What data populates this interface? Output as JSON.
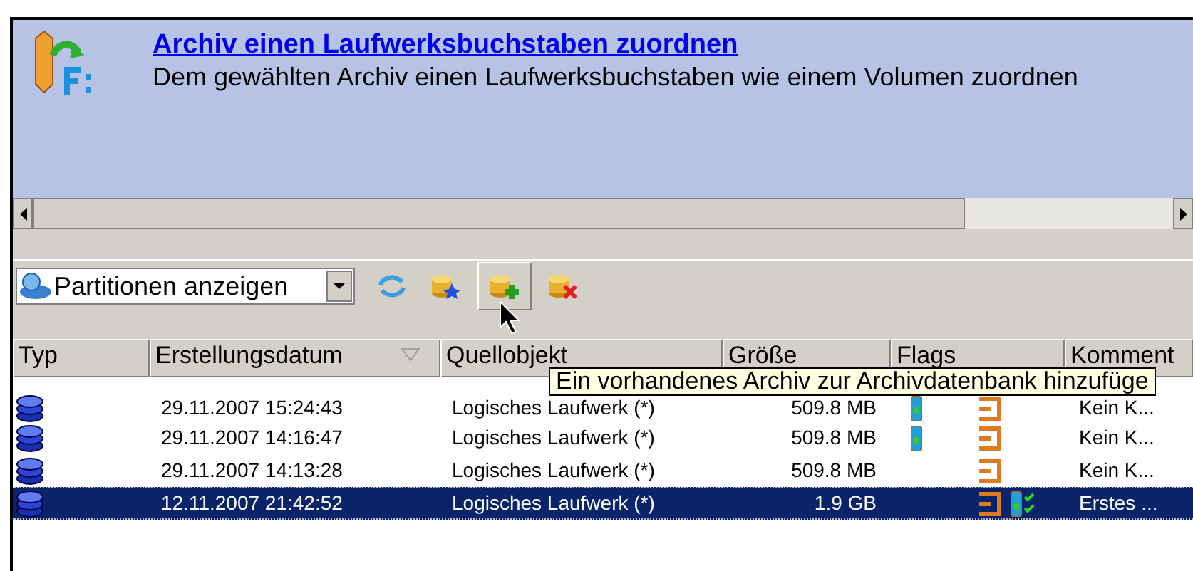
{
  "task": {
    "title": "Archiv einen Laufwerksbuchstaben zuordnen",
    "description": "Dem gewählten Archiv einen Laufwerksbuchstaben wie einem Volumen zuordnen"
  },
  "toolbar": {
    "view_select": {
      "value": "Partitionen anzeigen"
    },
    "buttons": [
      {
        "kind": "refresh",
        "hovered": false
      },
      {
        "kind": "new",
        "hovered": false
      },
      {
        "kind": "add",
        "hovered": true
      },
      {
        "kind": "delete",
        "hovered": false
      }
    ]
  },
  "tooltip": "Ein vorhandenes Archiv zur Archivdatenbank hinzufüge",
  "table": {
    "columns": [
      {
        "label": "Typ",
        "sorted": false
      },
      {
        "label": "Erstellungsdatum",
        "sorted": true
      },
      {
        "label": "Quellobjekt",
        "sorted": false
      },
      {
        "label": "Größe",
        "sorted": false
      },
      {
        "label": "Flags",
        "sorted": false
      },
      {
        "label": "Komment",
        "sorted": false
      }
    ],
    "rows": [
      {
        "date": "29.11.2007 15:24:43",
        "source": "Logisches Laufwerk (*)",
        "size": "509.8 MB",
        "image_flag": true,
        "verified": false,
        "comment": "Kein K...",
        "selected": false
      },
      {
        "date": "29.11.2007 14:16:47",
        "source": "Logisches Laufwerk (*)",
        "size": "509.8 MB",
        "image_flag": true,
        "verified": false,
        "comment": "Kein K...",
        "selected": false
      },
      {
        "date": "29.11.2007 14:13:28",
        "source": "Logisches Laufwerk (*)",
        "size": "509.8 MB",
        "image_flag": false,
        "verified": false,
        "comment": "Kein K...",
        "selected": false
      },
      {
        "date": "12.11.2007 21:42:52",
        "source": "Logisches Laufwerk (*)",
        "size": "1.9 GB",
        "image_flag": false,
        "verified": true,
        "comment": "Erstes ...",
        "selected": true
      }
    ]
  }
}
